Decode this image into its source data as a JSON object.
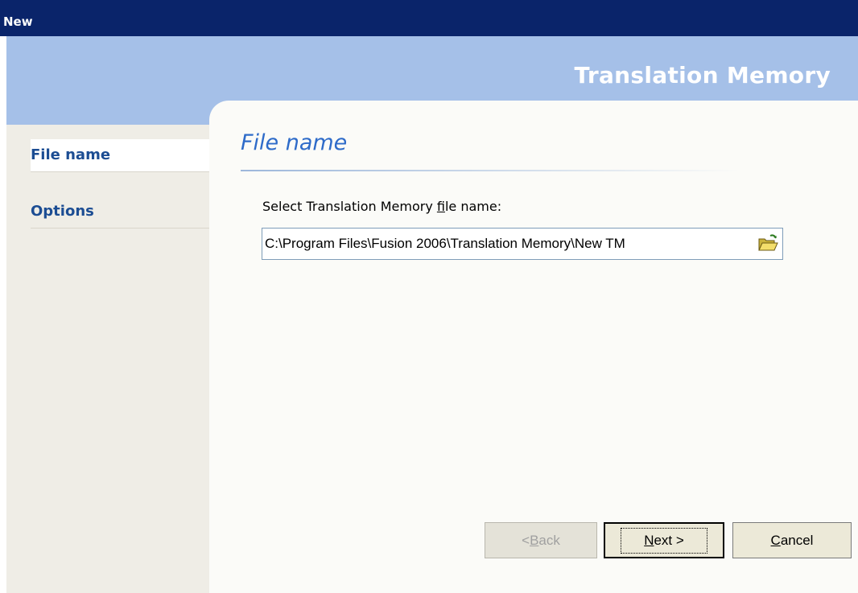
{
  "window": {
    "title": "New"
  },
  "banner": {
    "title": "Translation Memory"
  },
  "sidebar": {
    "items": [
      {
        "label": "File name"
      },
      {
        "label": "Options"
      }
    ]
  },
  "page": {
    "section_title": "File name",
    "field_label_pre": "Select Translation Memory ",
    "field_label_u": "f",
    "field_label_post": "ile name:",
    "path_value": "C:\\Program Files\\Fusion 2006\\Translation Memory\\New TM"
  },
  "buttons": {
    "back_pre": "< ",
    "back_u": "B",
    "back_post": "ack",
    "next_u": "N",
    "next_post": "ext >",
    "cancel_u": "C",
    "cancel_post": "ancel"
  },
  "icons": {
    "browse": "folder-open-icon"
  },
  "colors": {
    "titlebar": "#0a246a",
    "banner": "#a5c0e8",
    "accent_text": "#2e6bc9",
    "sidebar_text": "#1c4d93"
  }
}
